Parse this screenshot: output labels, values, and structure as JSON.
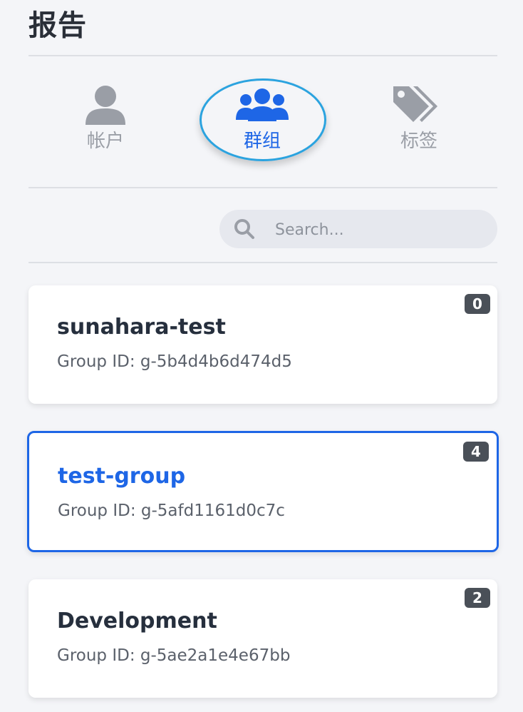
{
  "header": {
    "title": "报告"
  },
  "tabs": [
    {
      "label": "帐户",
      "icon": "user-icon",
      "active": false
    },
    {
      "label": "群组",
      "icon": "users-icon",
      "active": true
    },
    {
      "label": "标签",
      "icon": "tags-icon",
      "active": false
    }
  ],
  "search": {
    "placeholder": "Search...",
    "value": ""
  },
  "groups": [
    {
      "name": "sunahara-test",
      "id_text": "Group ID: g-5b4d4b6d474d5",
      "count": "0",
      "selected": false
    },
    {
      "name": "test-group",
      "id_text": "Group ID: g-5afd1161d0c7c",
      "count": "4",
      "selected": true
    },
    {
      "name": "Development",
      "id_text": "Group ID: g-5ae2a1e4e67bb",
      "count": "2",
      "selected": false
    }
  ],
  "colors": {
    "accent": "#1e66e6",
    "focus_ring": "#2ba3df",
    "inactive_icon": "#9a9ea6",
    "badge_bg": "#4a5058",
    "background": "#f4f5f8"
  }
}
